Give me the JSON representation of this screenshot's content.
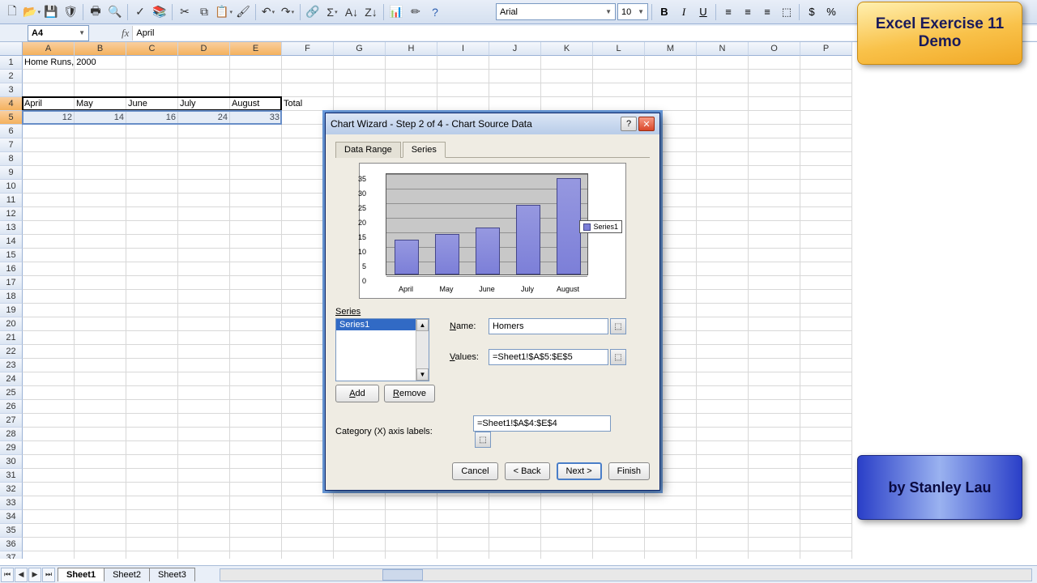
{
  "toolbar_icons": [
    "new",
    "open",
    "save",
    "perm",
    "search",
    "print",
    "preview",
    "spell",
    "research",
    "cut",
    "copy",
    "paste",
    "format-painter",
    "undo",
    "redo",
    "ink",
    "link",
    "sum",
    "sort-asc",
    "sort-desc",
    "chart",
    "drawing",
    "zoom",
    "help"
  ],
  "font": {
    "name": "Arial",
    "size": "10"
  },
  "namebox": "A4",
  "formula": "April",
  "columns": [
    "A",
    "B",
    "C",
    "D",
    "E",
    "F",
    "G",
    "H",
    "I",
    "J",
    "K",
    "L",
    "M",
    "N",
    "O",
    "P"
  ],
  "row_count": 37,
  "cells": {
    "A1": "Home Runs, 2000",
    "A4": "April",
    "B4": "May",
    "C4": "June",
    "D4": "July",
    "E4": "August",
    "F4": "Total",
    "A5": "12",
    "B5": "14",
    "C5": "16",
    "D5": "24",
    "E5": "33"
  },
  "selected_range": {
    "r1": 4,
    "c1": 1,
    "r2": 4,
    "c2": 5
  },
  "marquee_range": {
    "r1": 5,
    "c1": 1,
    "r2": 5,
    "c2": 5
  },
  "sheet_tabs": [
    "Sheet1",
    "Sheet2",
    "Sheet3"
  ],
  "active_tab": 0,
  "dialog": {
    "title": "Chart Wizard - Step 2 of 4 - Chart Source Data",
    "tabs": [
      "Data Range",
      "Series"
    ],
    "active_tab": 1,
    "series_list": [
      "Series1"
    ],
    "name_label": "Name:",
    "name_value": "Homers",
    "values_label": "Values:",
    "values_value": "=Sheet1!$A$5:$E$5",
    "category_label": "Category (X) axis labels:",
    "category_value": "=Sheet1!$A$4:$E$4",
    "add_btn": "Add",
    "remove_btn": "Remove",
    "series_section": "Series",
    "buttons": {
      "cancel": "Cancel",
      "back": "< Back",
      "next": "Next >",
      "finish": "Finish"
    },
    "legend_label": "Series1"
  },
  "chart_data": {
    "type": "bar",
    "categories": [
      "April",
      "May",
      "June",
      "July",
      "August"
    ],
    "values": [
      12,
      14,
      16,
      24,
      33
    ],
    "ylim": [
      0,
      35
    ],
    "yticks": [
      0,
      5,
      10,
      15,
      20,
      25,
      30,
      35
    ],
    "series_name": "Series1"
  },
  "badges": {
    "title1": "Excel Exercise 11",
    "title2": "Demo",
    "author": "by Stanley Lau"
  }
}
